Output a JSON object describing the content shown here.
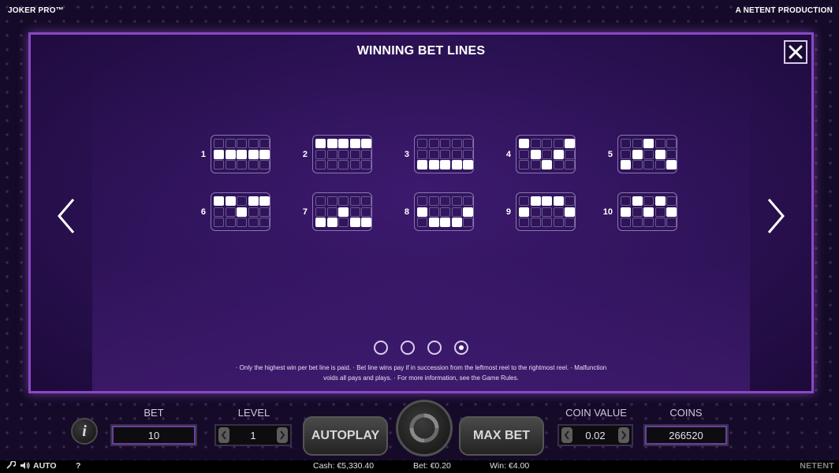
{
  "header": {
    "game_title": "JOKER PRO™",
    "producer": "A NETENT PRODUCTION"
  },
  "modal": {
    "title": "WINNING BET LINES",
    "close_icon": "close-x-icon",
    "prev_icon": "chevron-left-icon",
    "next_icon": "chevron-right-icon",
    "bet_lines": [
      {
        "number": "1",
        "pattern": [
          [
            0,
            0,
            0,
            0,
            0
          ],
          [
            1,
            1,
            1,
            1,
            1
          ],
          [
            0,
            0,
            0,
            0,
            0
          ]
        ]
      },
      {
        "number": "2",
        "pattern": [
          [
            1,
            1,
            1,
            1,
            1
          ],
          [
            0,
            0,
            0,
            0,
            0
          ],
          [
            0,
            0,
            0,
            0,
            0
          ]
        ]
      },
      {
        "number": "3",
        "pattern": [
          [
            0,
            0,
            0,
            0,
            0
          ],
          [
            0,
            0,
            0,
            0,
            0
          ],
          [
            1,
            1,
            1,
            1,
            1
          ]
        ]
      },
      {
        "number": "4",
        "pattern": [
          [
            1,
            0,
            0,
            0,
            1
          ],
          [
            0,
            1,
            0,
            1,
            0
          ],
          [
            0,
            0,
            1,
            0,
            0
          ]
        ]
      },
      {
        "number": "5",
        "pattern": [
          [
            0,
            0,
            1,
            0,
            0
          ],
          [
            0,
            1,
            0,
            1,
            0
          ],
          [
            1,
            0,
            0,
            0,
            1
          ]
        ]
      },
      {
        "number": "6",
        "pattern": [
          [
            1,
            1,
            0,
            1,
            1
          ],
          [
            0,
            0,
            1,
            0,
            0
          ],
          [
            0,
            0,
            0,
            0,
            0
          ]
        ]
      },
      {
        "number": "7",
        "pattern": [
          [
            0,
            0,
            0,
            0,
            0
          ],
          [
            0,
            0,
            1,
            0,
            0
          ],
          [
            1,
            1,
            0,
            1,
            1
          ]
        ]
      },
      {
        "number": "8",
        "pattern": [
          [
            0,
            0,
            0,
            0,
            0
          ],
          [
            1,
            0,
            0,
            0,
            1
          ],
          [
            0,
            1,
            1,
            1,
            0
          ]
        ]
      },
      {
        "number": "9",
        "pattern": [
          [
            0,
            1,
            1,
            1,
            0
          ],
          [
            1,
            0,
            0,
            0,
            1
          ],
          [
            0,
            0,
            0,
            0,
            0
          ]
        ]
      },
      {
        "number": "10",
        "pattern": [
          [
            0,
            1,
            0,
            1,
            0
          ],
          [
            1,
            0,
            1,
            0,
            1
          ],
          [
            0,
            0,
            0,
            0,
            0
          ]
        ]
      }
    ],
    "pages": [
      false,
      false,
      false,
      true
    ],
    "rules_line1": "· Only the highest win per bet line is paid. · Bet line wins pay if in succession from the leftmost reel to the rightmost reel. · Malfunction",
    "rules_line2": "voids all pays and plays. · For more information, see the Game Rules."
  },
  "controls": {
    "info_label": "i",
    "bet_label": "BET",
    "bet_value": "10",
    "level_label": "LEVEL",
    "level_value": "1",
    "autoplay_label": "AUTOPLAY",
    "spin_icon": "spin-arrows-icon",
    "max_bet_label": "MAX BET",
    "coin_value_label": "COIN VALUE",
    "coin_value": "0.02",
    "coins_label": "COINS",
    "coins_value": "266520"
  },
  "status_bar": {
    "wrench_icon": "wrench-icon",
    "sound_icon": "speaker-icon",
    "auto_label": "AUTO",
    "help_label": "?",
    "cash": "Cash: €5,330.40",
    "bet": "Bet: €0.20",
    "win": "Win: €4.00",
    "brand": "NETENT"
  },
  "colors": {
    "modal_border": "#8a48c4",
    "accent_purple": "#6a3ea0"
  }
}
